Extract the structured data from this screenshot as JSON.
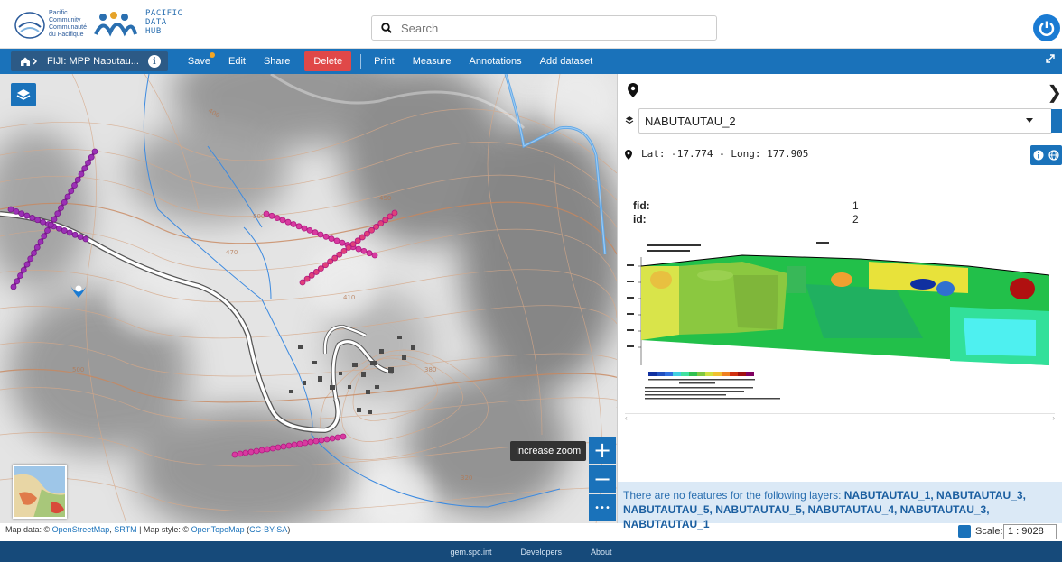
{
  "header": {
    "logo_lines": [
      "Pacific",
      "Community",
      "Communauté",
      "du Pacifique"
    ],
    "logo_hub": [
      "PACIFIC",
      "DATA",
      "HUB"
    ],
    "search_placeholder": "Search",
    "search_icon": "search-icon",
    "power_icon": "power-icon"
  },
  "toolbar": {
    "breadcrumb": "FIJI: MPP Nabutau...",
    "buttons": {
      "save": "Save",
      "edit": "Edit",
      "share": "Share",
      "delete": "Delete",
      "print": "Print",
      "measure": "Measure",
      "annotations": "Annotations",
      "add_dataset": "Add dataset"
    },
    "colors": {
      "bar": "#1a72ba",
      "delete": "#e04848",
      "breadcrumb": "#2c5a86"
    }
  },
  "map": {
    "zoom_tooltip": "Increase zoom",
    "zoom_in": "+",
    "zoom_out": "−",
    "more": "•••",
    "attribution": {
      "prefix": "Map data: © ",
      "osm": "OpenStreetMap",
      "sep1": ", ",
      "srtm": "SRTM",
      "mid": " | Map style: © ",
      "otm": "OpenTopoMap",
      "space": " (",
      "license": "CC-BY-SA",
      "close": ")"
    },
    "scale_label": "Scale:",
    "scale_value": "1 : 9028"
  },
  "panel": {
    "layer": "NABUTAUTAU_2",
    "latlong": "Lat: -17.774 - Long: 177.905",
    "attributes": [
      {
        "key": "fid:",
        "value": "1"
      },
      {
        "key": "id:",
        "value": "2"
      }
    ],
    "notice_prefix": "There are no features for the following layers: ",
    "notice_layers": "NABUTAUTAU_1, NABUTAUTAU_3, NABUTAUTAU_5, NABUTAUTAU_5, NABUTAUTAU_4, NABUTAUTAU_3, NABUTAUTAU_1"
  },
  "footer": {
    "links": [
      "gem.spc.int",
      "Developers",
      "About"
    ]
  }
}
